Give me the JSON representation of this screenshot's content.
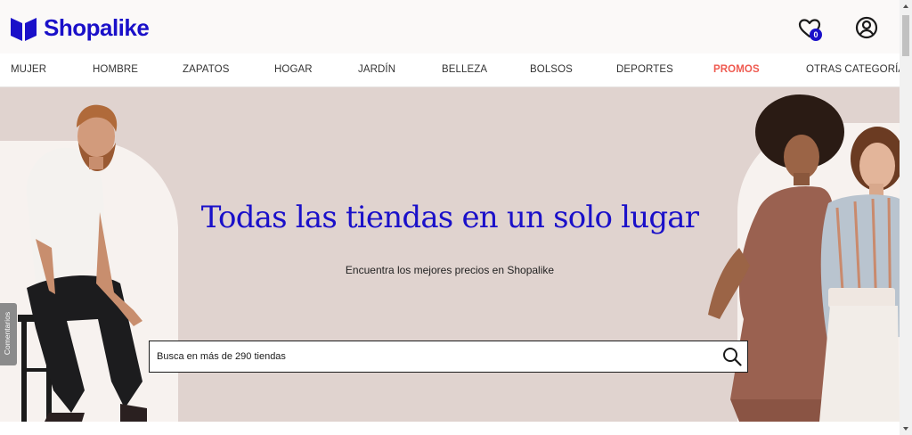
{
  "brand": {
    "name": "Shopalike",
    "color": "#1a10c9"
  },
  "header": {
    "wishlist_count": "0",
    "wishlist_icon": "heart-icon",
    "account_icon": "user-circle-icon"
  },
  "nav": {
    "items": [
      {
        "label": "MUJER"
      },
      {
        "label": "HOMBRE"
      },
      {
        "label": "ZAPATOS"
      },
      {
        "label": "HOGAR"
      },
      {
        "label": "JARDÍN"
      },
      {
        "label": "BELLEZA"
      },
      {
        "label": "BOLSOS"
      },
      {
        "label": "DEPORTES"
      },
      {
        "label": "PROMOS",
        "accent": "#ef5a50"
      },
      {
        "label": "OTRAS CATEGORÍAS"
      }
    ]
  },
  "hero": {
    "title": "Todas las tiendas en un solo lugar",
    "subtitle": "Encuentra los mejores precios en Shopalike",
    "search_placeholder": "Busca en más de 290 tiendas",
    "search_icon": "search-icon"
  },
  "feedback_tab": {
    "label": "Comentarios"
  },
  "colors": {
    "hero_bg": "#e0d3cf",
    "promo": "#ef5a50"
  }
}
